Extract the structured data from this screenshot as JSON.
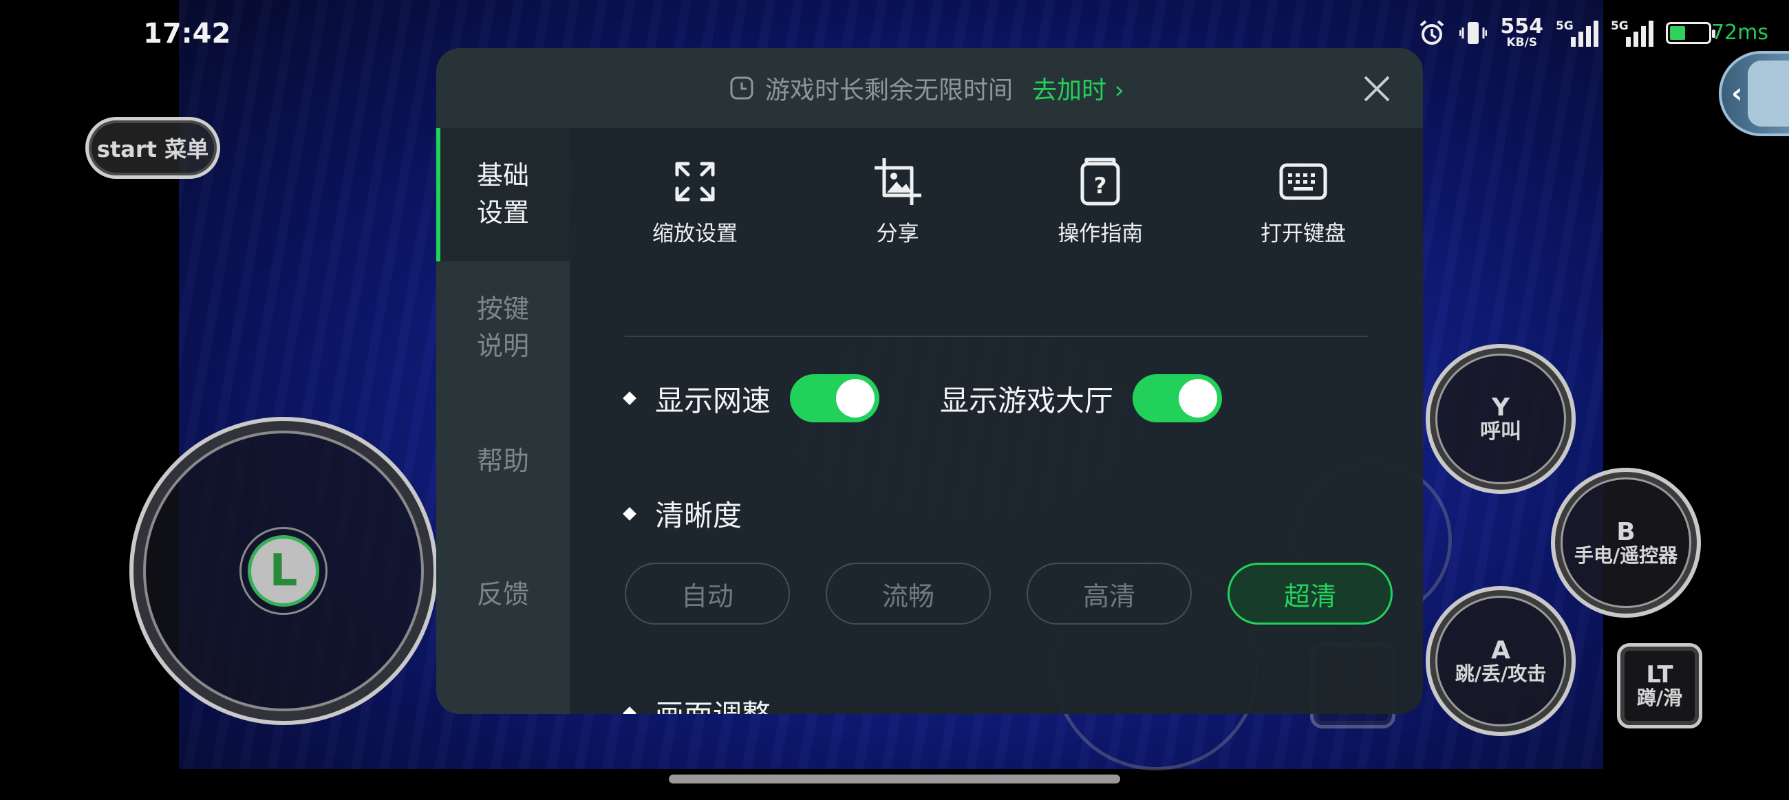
{
  "status_bar": {
    "time": "17:42",
    "net_speed": "554",
    "net_speed_unit": "KB/S",
    "sim1_tag": "5G",
    "sim2_tag": "5G",
    "ping": "72ms"
  },
  "game_controls": {
    "start_menu": "start 菜单",
    "joystick": "L",
    "btn_y_key": "Y",
    "btn_y_action": "呼叫",
    "btn_b_key": "B",
    "btn_b_action": "手电/遥控器",
    "btn_a_key": "A",
    "btn_a_action": "跳/丢/攻击",
    "btn_lt_key": "LT",
    "btn_lt_action": "蹲/滑"
  },
  "panel": {
    "notice_text": "游戏时长剩余无限时间",
    "notice_action": "去加时 ›",
    "sidebar": {
      "items": [
        {
          "label": "基础\n设置",
          "active": true
        },
        {
          "label": "按键\n说明",
          "active": false
        },
        {
          "label": "帮助",
          "active": false
        },
        {
          "label": "反馈",
          "active": false
        }
      ]
    },
    "quick_actions": [
      {
        "label": "缩放设置",
        "icon": "expand-icon"
      },
      {
        "label": "分享",
        "icon": "crop-image-icon"
      },
      {
        "label": "操作指南",
        "icon": "guide-book-icon"
      },
      {
        "label": "打开键盘",
        "icon": "keyboard-icon"
      }
    ],
    "toggles": {
      "show_net_speed": {
        "label": "显示网速",
        "on": true
      },
      "show_game_lobby": {
        "label": "显示游戏大厅",
        "on": true
      }
    },
    "clarity": {
      "title": "清晰度",
      "options": [
        "自动",
        "流畅",
        "高清",
        "超清"
      ],
      "selected": "超清"
    },
    "picture_adjust": {
      "title": "画面调整"
    }
  },
  "colors": {
    "accent": "#22d15a",
    "panel_bg": "#1e262a",
    "sidebar_bg": "#293539",
    "muted_text": "#7c878c"
  }
}
